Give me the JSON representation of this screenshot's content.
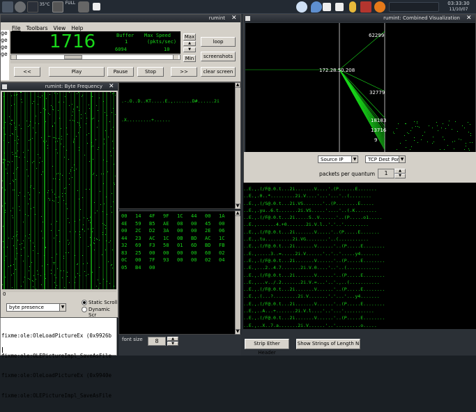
{
  "taskbar": {
    "left_labels": [
      "35°C",
      "FULL"
    ],
    "clock_time": "03:33:30",
    "clock_date": "11/10/07"
  },
  "main": {
    "title": "rumint",
    "menu": [
      "File",
      "Toolbars",
      "View",
      "Help"
    ],
    "packet_count": "1716",
    "buffer_label": "Buffer",
    "max_speed_label": "Max Speed",
    "pkts_label": "(pkts/sec)",
    "buffer_value": "1",
    "buffer_value2": "6094",
    "speed_value": "10",
    "max_label": "Max",
    "min_label": "Min",
    "loop_label": "loop",
    "screenshots_label": "screenshots",
    "clear_label": "clear screen",
    "rewind_label": "<<",
    "play_label": "Play",
    "pause_label": "Pause",
    "stop_label": "Stop",
    "ff_label": ">>"
  },
  "byte_freq": {
    "title": "rumint: Byte Frequency",
    "axis_zero": "0",
    "mode_select": "byte presence",
    "radio_static": "Static Scroll",
    "radio_dynamic": "Dynamic Scr"
  },
  "ascii_top": {
    "lines": [
      ".-.O..D..KT.....E.,.......D#......2i",
      ".X.........+......"
    ]
  },
  "hex_pane": {
    "rows": [
      [
        "00",
        "14",
        "4F",
        "9F",
        "1C",
        "44",
        "00",
        "1A"
      ],
      [
        "4E",
        "59",
        "B5",
        "AE",
        "08",
        "00",
        "45",
        "00"
      ],
      [
        "00",
        "2C",
        "D2",
        "3A",
        "00",
        "00",
        "2E",
        "06"
      ],
      [
        "44",
        "23",
        "AC",
        "1C",
        "0B",
        "BD",
        "AC",
        "1C"
      ],
      [
        "32",
        "69",
        "F3",
        "58",
        "01",
        "6D",
        "BD",
        "FB"
      ],
      [
        "83",
        "25",
        "00",
        "00",
        "00",
        "00",
        "60",
        "02"
      ],
      [
        "0C",
        "00",
        "7F",
        "93",
        "00",
        "00",
        "02",
        "04"
      ],
      [
        "05",
        "B4",
        "00"
      ]
    ]
  },
  "font_size": {
    "label": "font size",
    "value": "8"
  },
  "console": {
    "lines": [
      "fixme:ole:OleLoadPictureEx (0x9926b",
      "fixme:ole:OLEPictureImpl_SaveAsFile",
      "fixme:ole:OleLoadPictureEx (0x9940e",
      "fixme:ole:OLEPictureImpl_SaveAsFile"
    ],
    "gt_lines": [
      "ge",
      "ge",
      "ge",
      "ge"
    ]
  },
  "combined": {
    "title": "rumint: Combined Visualization",
    "labels": {
      "l62299": "62299",
      "lip": "172.28.50.208",
      "l32779": "32779",
      "l18183": "18183",
      "l13716": "13716",
      "l9": "9"
    },
    "axis_left": "Source IP",
    "axis_right": "TCP Dest Port",
    "packets_per_quantum_label": "packets per quantum",
    "packets_per_quantum_value": "1"
  },
  "strings": {
    "lines": [
      "..E.,.(/F@.0.t...2i.......V....'.(P......E.......",
      "..E.,.0..*.........2i.V....'...'...'..(........",
      "..E.,.(/S@.0.t...2i.VS.......'..(P........E.....",
      "..E.,.yu..6.t.......2i.VS.....'....'..(.K........",
      "..E.,.(/F@.0.t...2i.....S..V......'..(P.....o1.....",
      "..E.,.......4.+0.......2i.V.l..'.'..'.........",
      "..E.,.(/F@.0.t...2i.......V.....'..(P.....E.......",
      "..E.,.tu..........2i.VG........'..(...........",
      "..E.,.(/F@.0.t...2i.......V......'..(P.....E........",
      "..E.,.....3..=.....2i.V......'..'..'.....y4.......",
      "..E.,.(/F@.0.t...2i.......V......'..(P.....E........",
      "..E.,...2..4.7.......2i.V.0....'..'..(............",
      "..E.,.(/F@.0.t...2i.......V......'..(P.....E........",
      "..E.,...v../.2.......2i.V.=...'..'.,..(...........",
      "..E.,.(/F@.0.t...2i.......V......'..(P.....E........",
      "..E.,.(...?.........2i.V.......'.'...'...y4.......",
      "..E.,.(/F@.0.t...2i.......V......'..(P.....E........",
      "..E.,..A...+.......2i.V.l....'..'...'...........",
      "..E.,.(/F@.0.t...2i.......V......'..(P.....E........",
      "..E.,..X..7.a.......2i.V......'..'.........o....."
    ],
    "strip_label": "Strip Ether Header",
    "show_label": "Show Strings of Length N"
  },
  "colors": {
    "plot_green": "#19d81a",
    "desktop": "#1a1f24"
  }
}
